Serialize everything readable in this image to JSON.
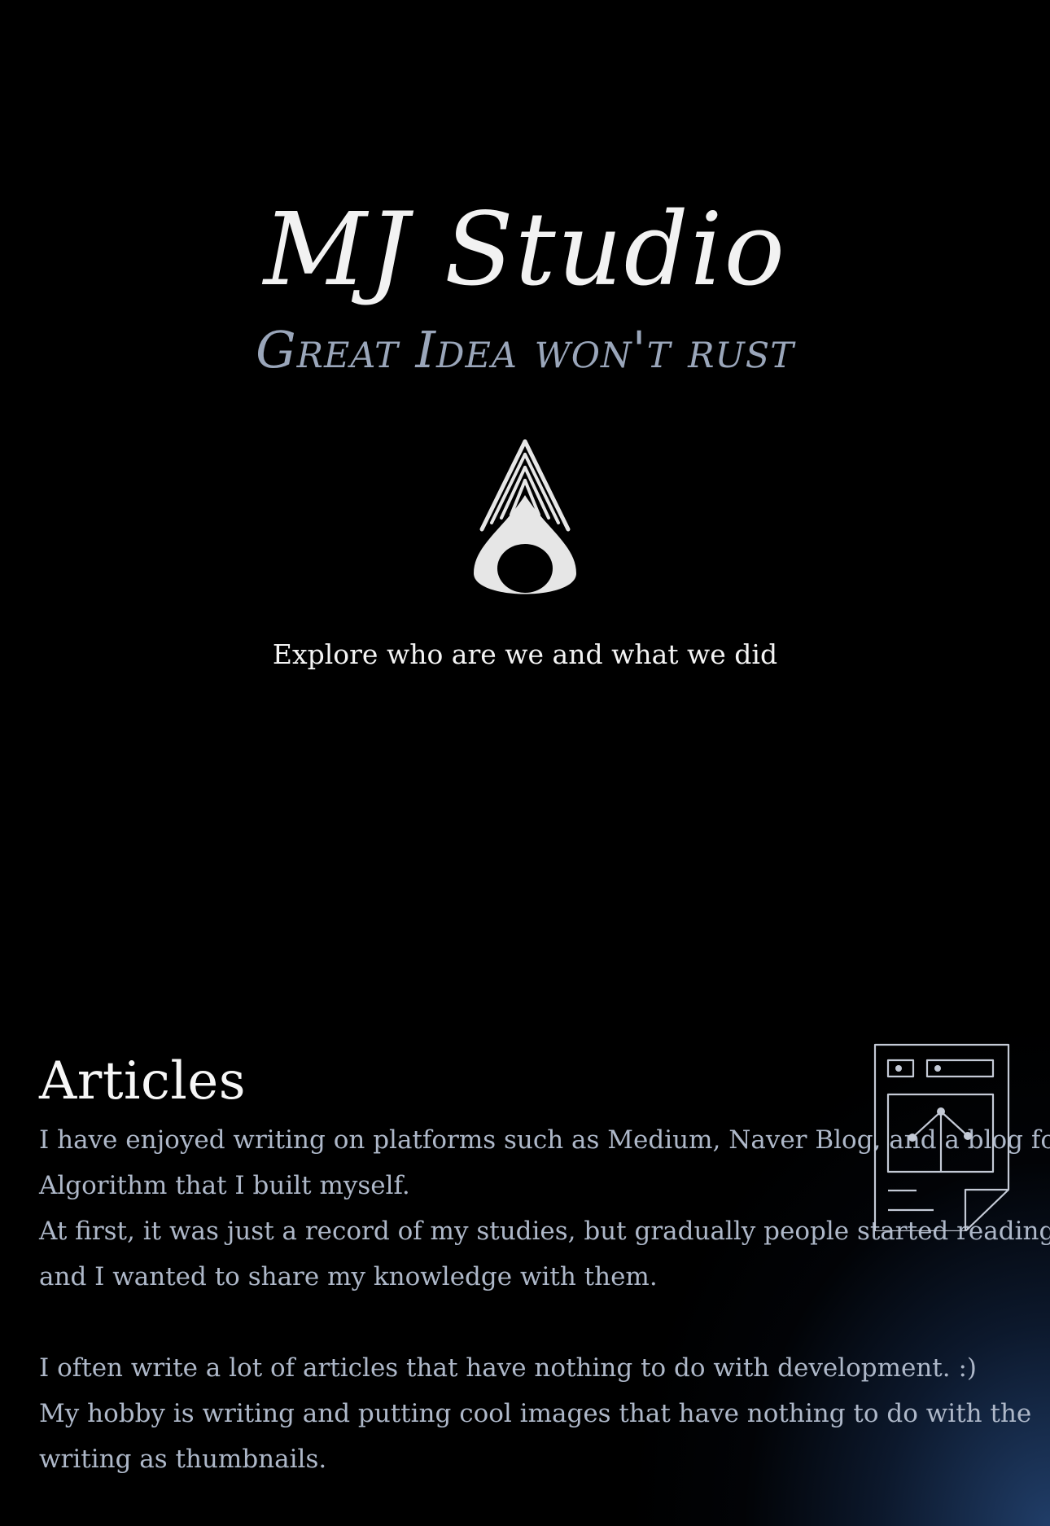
{
  "hero": {
    "title": "MJ Studio",
    "tagline": "Great Idea won't rust",
    "logo_icon": "water-drop-icon",
    "explore_text": "Explore who are we and what we did"
  },
  "articles": {
    "heading": "Articles",
    "illustration_icon": "document-chart-icon",
    "lines": [
      "I have enjoyed writing on platforms such as Medium, Naver Blog, and a blog for",
      "Algorithm that I built myself.",
      "At first, it was just a record of my studies, but gradually people started reading it",
      "and I wanted to share my knowledge with them.",
      "I often write a lot of articles that have nothing to do with development. :)",
      "My hobby is writing and putting cool images that have nothing to do with the",
      "writing as thumbnails."
    ]
  },
  "colors": {
    "background": "#000000",
    "title": "#f2f2f2",
    "tagline": "#9aa6ba",
    "body_text": "#aeb8c9",
    "glow": "#26487a"
  }
}
